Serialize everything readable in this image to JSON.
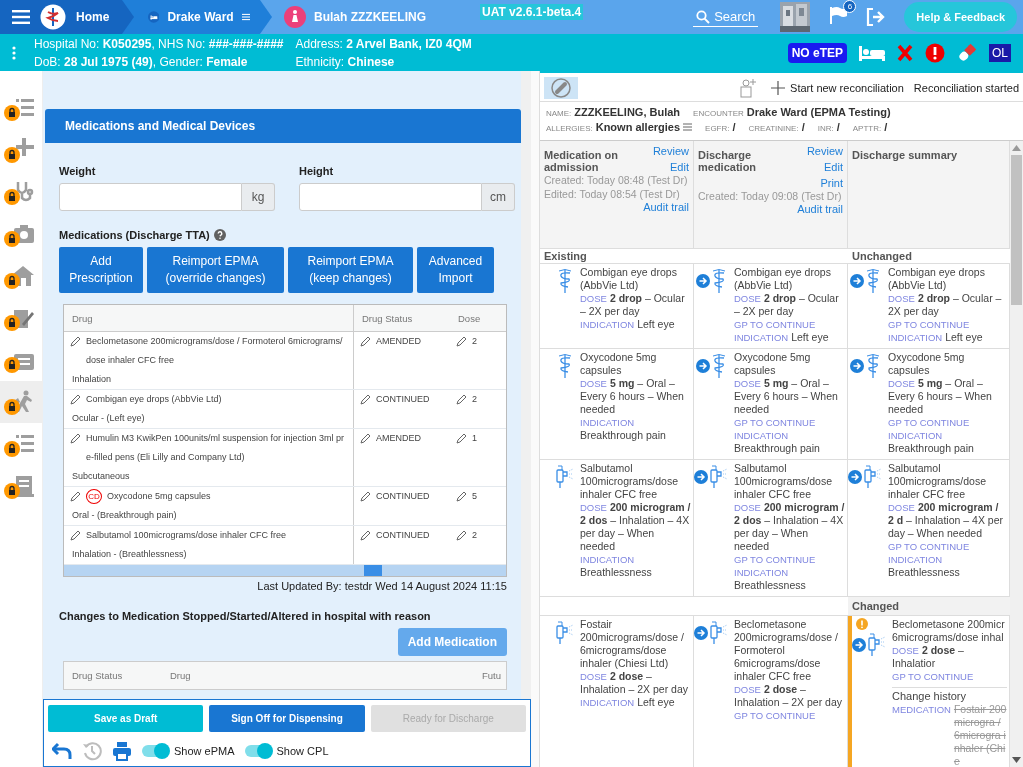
{
  "topbar": {
    "home": "Home",
    "ward": "Drake Ward",
    "patient": "Bulah ZZZKEELING",
    "version": "UAT v2.6.1-beta.4",
    "search": "Search",
    "notifications": "6",
    "help": "Help & Feedback"
  },
  "banner": {
    "left": [
      "Hospital No: **K050295**, NHS No: **###-###-####**",
      "DoB: **28 Jul 1975 (49)**, Gender: **Female**"
    ],
    "right": [
      "Address: **2 Arvel Bank, IZ0 4QM**",
      "Ethnicity: **Chinese**"
    ],
    "etep": "NO eTEP",
    "ol": "OL"
  },
  "sidebar": {
    "items": [
      {
        "kind": "list",
        "locked": true,
        "selected": false
      },
      {
        "kind": "plus",
        "locked": true,
        "selected": false
      },
      {
        "kind": "stethoscope",
        "locked": true,
        "selected": false
      },
      {
        "kind": "camera",
        "locked": true,
        "selected": false
      },
      {
        "kind": "home",
        "locked": true,
        "selected": false
      },
      {
        "kind": "edit",
        "locked": true,
        "selected": false
      },
      {
        "kind": "clipboard",
        "locked": true,
        "selected": false
      },
      {
        "kind": "walk",
        "locked": true,
        "selected": true
      },
      {
        "kind": "list",
        "locked": true,
        "selected": false
      },
      {
        "kind": "receipt",
        "locked": true,
        "selected": false
      }
    ]
  },
  "form": {
    "title": "Medications and Medical Devices",
    "fields": [
      {
        "label": "Weight",
        "unit": "kg"
      },
      {
        "label": "Height",
        "unit": "cm"
      }
    ],
    "meds_label": "Medications (Discharge TTA)",
    "actions": [
      "Add Prescription",
      "Reimport EPMA (override changes)",
      "Reimport EPMA (keep changes)",
      "Advanced Import"
    ]
  },
  "table": {
    "columns": [
      "Drug",
      "Drug Status",
      "Dose"
    ],
    "rows": [
      {
        "drug": "Beclometasone 200micrograms/dose / Formoterol 6micrograms/dose inhaler CFC free",
        "route": "Inhalation",
        "status": "AMENDED",
        "dose": "2"
      },
      {
        "drug": "Combigan eye drops (AbbVie Ltd)",
        "route": "Ocular - (Left eye)",
        "status": "CONTINUED",
        "dose": "2"
      },
      {
        "drug": "Humulin M3 KwikPen 100units/ml suspension for injection 3ml pre-filled pens (Eli Lilly and Company Ltd)",
        "route": "Subcutaneous",
        "status": "AMENDED",
        "dose": "1"
      },
      {
        "drug": "Oxycodone 5mg capsules",
        "badge": "CD",
        "route": "Oral - (Breakthrough pain)",
        "status": "CONTINUED",
        "dose": "5"
      },
      {
        "drug": "Salbutamol 100micrograms/dose inhaler CFC free",
        "route": "Inhalation - (Breathlessness)",
        "status": "CONTINUED",
        "dose": "2"
      }
    ]
  },
  "last_updated": "Last Updated By: testdr Wed 14 August 2024 11:15",
  "changes": {
    "title": "Changes to Medication Stopped/Started/Altered in hospital with reason",
    "add": "Add Medication",
    "columns": [
      "Drug Status",
      "Drug",
      "Futu"
    ]
  },
  "footer": {
    "buttons": [
      {
        "label": "Save as Draft",
        "kind": "draft",
        "disabled": false
      },
      {
        "label": "Sign Off for Dispensing",
        "kind": "primary",
        "disabled": false
      },
      {
        "label": "Ready for Discharge",
        "kind": "primary",
        "disabled": true
      }
    ],
    "toggles": [
      {
        "label": "Show ePMA",
        "on": true
      },
      {
        "label": "Show CPL",
        "on": true
      }
    ]
  },
  "reconciliation": {
    "new": "Start new reconciliation",
    "status": "Reconciliation started",
    "patient": {
      "name_label": "NAME:",
      "name": "ZZZKEELING, Bulah",
      "encounter_label": "ENCOUNTER",
      "encounter": "Drake Ward (EPMA Testing)",
      "allergies_label": "ALLERGIES:",
      "allergies": "Known allergies",
      "labs": [
        {
          "label": "EGFR:",
          "value": "/"
        },
        {
          "label": "CREATININE:",
          "value": "/"
        },
        {
          "label": "INR:",
          "value": "/"
        },
        {
          "label": "APTTR:",
          "value": "/"
        }
      ]
    },
    "panels": [
      {
        "title": "Medication on admission",
        "links": [
          "Review",
          "Edit"
        ],
        "meta": [
          "Created: Today 08:48 (Test Dr)",
          "Edited: Today 08:54 (Test Dr)"
        ],
        "audit": "Audit trail"
      },
      {
        "title": "Discharge medication",
        "links": [
          "Review",
          "Edit",
          "Print"
        ],
        "meta": [
          "Created: Today 09:08 (Test Dr)"
        ],
        "audit": "Audit trail"
      },
      {
        "title": "Discharge summary"
      }
    ],
    "groups": [
      {
        "headings": {
          "left": "Existing",
          "right": "Unchanged"
        },
        "rows": [
          [
            {
              "kind": "general",
              "transfer": false,
              "warning": false,
              "name": "Combigan eye drops (AbbVie Ltd)",
              "fields": [
                {
                  "label": "DOSE",
                  "value": "**2 drop** – Ocular – 2X per day"
                },
                {
                  "label": "INDICATION",
                  "value": "Left eye"
                }
              ]
            },
            {
              "kind": "general",
              "transfer": true,
              "warning": false,
              "name": "Combigan eye drops (AbbVie Ltd)",
              "fields": [
                {
                  "label": "DOSE",
                  "value": "**2 drop** – Ocular – 2X per day"
                },
                {
                  "label": "GP TO CONTINUE"
                },
                {
                  "label": "INDICATION",
                  "value": "Left eye"
                }
              ]
            },
            {
              "kind": "general",
              "transfer": true,
              "warning": false,
              "name": "Combigan eye drops (AbbVie Ltd)",
              "fields": [
                {
                  "label": "DOSE",
                  "value": "**2 drop** – Ocular – 2X per day"
                },
                {
                  "label": "GP TO CONTINUE"
                },
                {
                  "label": "INDICATION",
                  "value": "Left eye"
                }
              ]
            }
          ],
          [
            {
              "kind": "general",
              "transfer": false,
              "warning": false,
              "name": "Oxycodone 5mg capsules",
              "fields": [
                {
                  "label": "DOSE",
                  "value": "**5 mg** – Oral – Every 6 hours – When needed"
                },
                {
                  "label": "INDICATION",
                  "value": "Breakthrough pain"
                }
              ]
            },
            {
              "kind": "general",
              "transfer": true,
              "warning": false,
              "name": "Oxycodone 5mg capsules",
              "fields": [
                {
                  "label": "DOSE",
                  "value": "**5 mg** – Oral – Every 6 hours – When needed"
                },
                {
                  "label": "GP TO CONTINUE"
                },
                {
                  "label": "INDICATION",
                  "value": "Breakthrough pain"
                }
              ]
            },
            {
              "kind": "general",
              "transfer": true,
              "warning": false,
              "name": "Oxycodone 5mg capsules",
              "fields": [
                {
                  "label": "DOSE",
                  "value": "**5 mg** – Oral – Every 6 hours – When needed"
                },
                {
                  "label": "GP TO CONTINUE"
                },
                {
                  "label": "INDICATION",
                  "value": "Breakthrough pain"
                }
              ]
            }
          ],
          [
            {
              "kind": "inhaler",
              "transfer": false,
              "warning": false,
              "name": "Salbutamol 100micrograms/dose inhaler CFC free",
              "fields": [
                {
                  "label": "DOSE",
                  "value": "**200 microgram / 2 dos** – Inhalation – 4X per day – When needed"
                },
                {
                  "label": "INDICATION",
                  "value": "Breathlessness"
                }
              ]
            },
            {
              "kind": "inhaler",
              "transfer": true,
              "warning": false,
              "name": "Salbutamol 100micrograms/dose inhaler CFC free",
              "fields": [
                {
                  "label": "DOSE",
                  "value": "**200 microgram / 2 dos** – Inhalation – 4X per day – When needed"
                },
                {
                  "label": "GP TO CONTINUE"
                },
                {
                  "label": "INDICATION",
                  "value": "Breathlessness"
                }
              ]
            },
            {
              "kind": "inhaler",
              "transfer": true,
              "warning": false,
              "name": "Salbutamol 100micrograms/dose inhaler CFC free",
              "fields": [
                {
                  "label": "DOSE",
                  "value": "**200 microgram / 2 d** – Inhalation – 4X per day – When needed"
                },
                {
                  "label": "GP TO CONTINUE"
                },
                {
                  "label": "INDICATION",
                  "value": "Breathlessness"
                }
              ]
            }
          ]
        ]
      },
      {
        "headings": {
          "right": "Changed"
        },
        "rows": [
          [
            {
              "kind": "inhaler",
              "transfer": false,
              "warning": false,
              "name": "Fostair 200micrograms/dose / 6micrograms/dose inhaler (Chiesi Ltd)",
              "fields": [
                {
                  "label": "DOSE",
                  "value": "**2 dose** – Inhalation – 2X per day"
                },
                {
                  "label": "INDICATION",
                  "value": "Left eye"
                }
              ]
            },
            {
              "kind": "inhaler",
              "transfer": true,
              "warning": false,
              "name": "Beclometasone 200micrograms/dose / Formoterol 6micrograms/dose inhaler CFC free",
              "fields": [
                {
                  "label": "DOSE",
                  "value": "**2 dose** – Inhalation – 2X per day"
                },
                {
                  "label": "GP TO CONTINUE"
                }
              ]
            },
            {
              "kind": "inhaler",
              "transfer": true,
              "warning": true,
              "name": "Beclometasone 200micr 6micrograms/dose inhal",
              "fields": [
                {
                  "label": "DOSE",
                  "value": "**2 dose** – Inhalatior"
                },
                {
                  "label": "GP TO CONTINUE"
                }
              ],
              "history": {
                "title": "Change history",
                "label": "MEDICATION",
                "old": "Fostair 200microgra / 6microgra inhaler (Chie"
              }
            }
          ]
        ]
      }
    ]
  }
}
